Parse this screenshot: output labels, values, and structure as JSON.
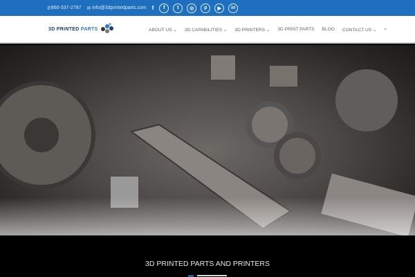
{
  "topbar": {
    "phone": "860-337-2787",
    "email": "info@3dprintedparts.com",
    "social": [
      "facebook-icon",
      "facebook-icon",
      "twitter-icon",
      "instagram-icon",
      "pinterest-icon",
      "youtube-icon",
      "linkedin-icon"
    ],
    "social_glyphs": [
      "f",
      "f",
      "t",
      "◎",
      "p",
      "▶",
      "in"
    ]
  },
  "header": {
    "logo": {
      "part1": "3D PRINTED ",
      "part2": "PARTS"
    },
    "nav": [
      "ABOUT US ⌄",
      "3D CAPABILITIES ⌄",
      "3D PRINTERS ⌄",
      "3D PRINT PARTS",
      "BLOG",
      "CONTACT US ⌄"
    ]
  },
  "hero": {
    "title": "3D PRINTED PARTS AND PRINTERS"
  },
  "colors": {
    "brand": "#1e6fc0",
    "logo": "#1c3e78"
  }
}
